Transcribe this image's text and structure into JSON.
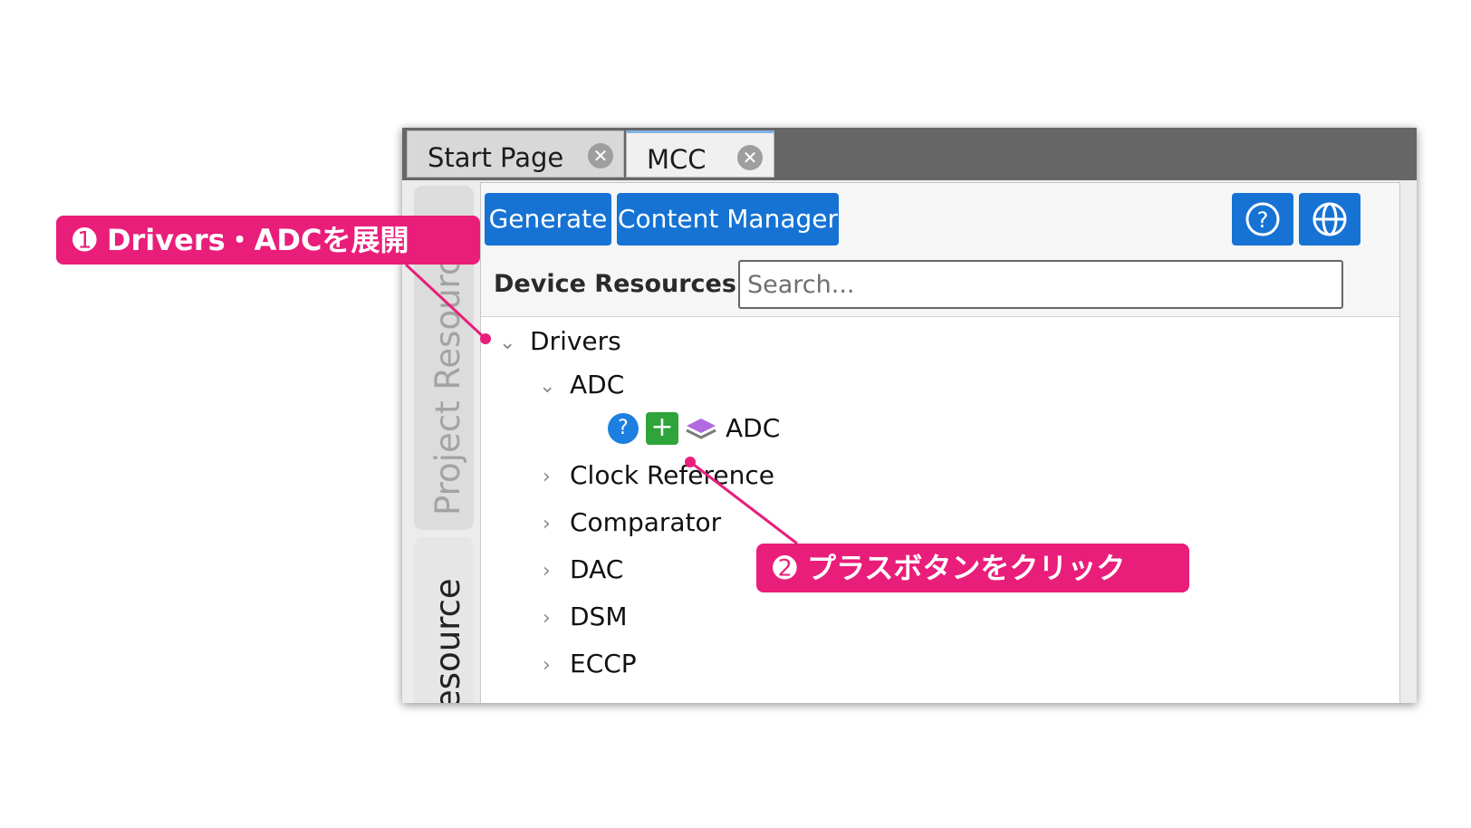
{
  "tabs": [
    {
      "label": "Start Page",
      "close_icon": "close-icon",
      "active": false
    },
    {
      "label": "MCC",
      "close_icon": "close-icon",
      "active": true
    }
  ],
  "side_tabs": {
    "project": "Project Resources",
    "resource": "Resource"
  },
  "toolbar": {
    "generate_label": "Generate",
    "content_manager_label": "Content Manager",
    "help_icon": "help-icon",
    "globe_icon": "globe-icon"
  },
  "device_resources": {
    "label": "Device Resources",
    "search_placeholder": "Search..."
  },
  "tree": {
    "drivers": {
      "label": "Drivers",
      "expanded": true
    },
    "adc_group": {
      "label": "ADC",
      "expanded": true
    },
    "adc_leaf": {
      "label": "ADC",
      "help_glyph": "?",
      "add_glyph": "+"
    },
    "items": [
      {
        "label": "Clock Reference",
        "expanded": false
      },
      {
        "label": "Comparator",
        "expanded": false
      },
      {
        "label": "DAC",
        "expanded": false
      },
      {
        "label": "DSM",
        "expanded": false
      },
      {
        "label": "ECCP",
        "expanded": false
      }
    ]
  },
  "annotations": {
    "step1": "➊ Drivers・ADCを展開",
    "step2": "➋ プラスボタンをクリック"
  },
  "colors": {
    "accent_blue": "#1673d4",
    "callout_pink": "#e91e7a",
    "add_green": "#2ea43a",
    "tab_bar": "#666666"
  }
}
